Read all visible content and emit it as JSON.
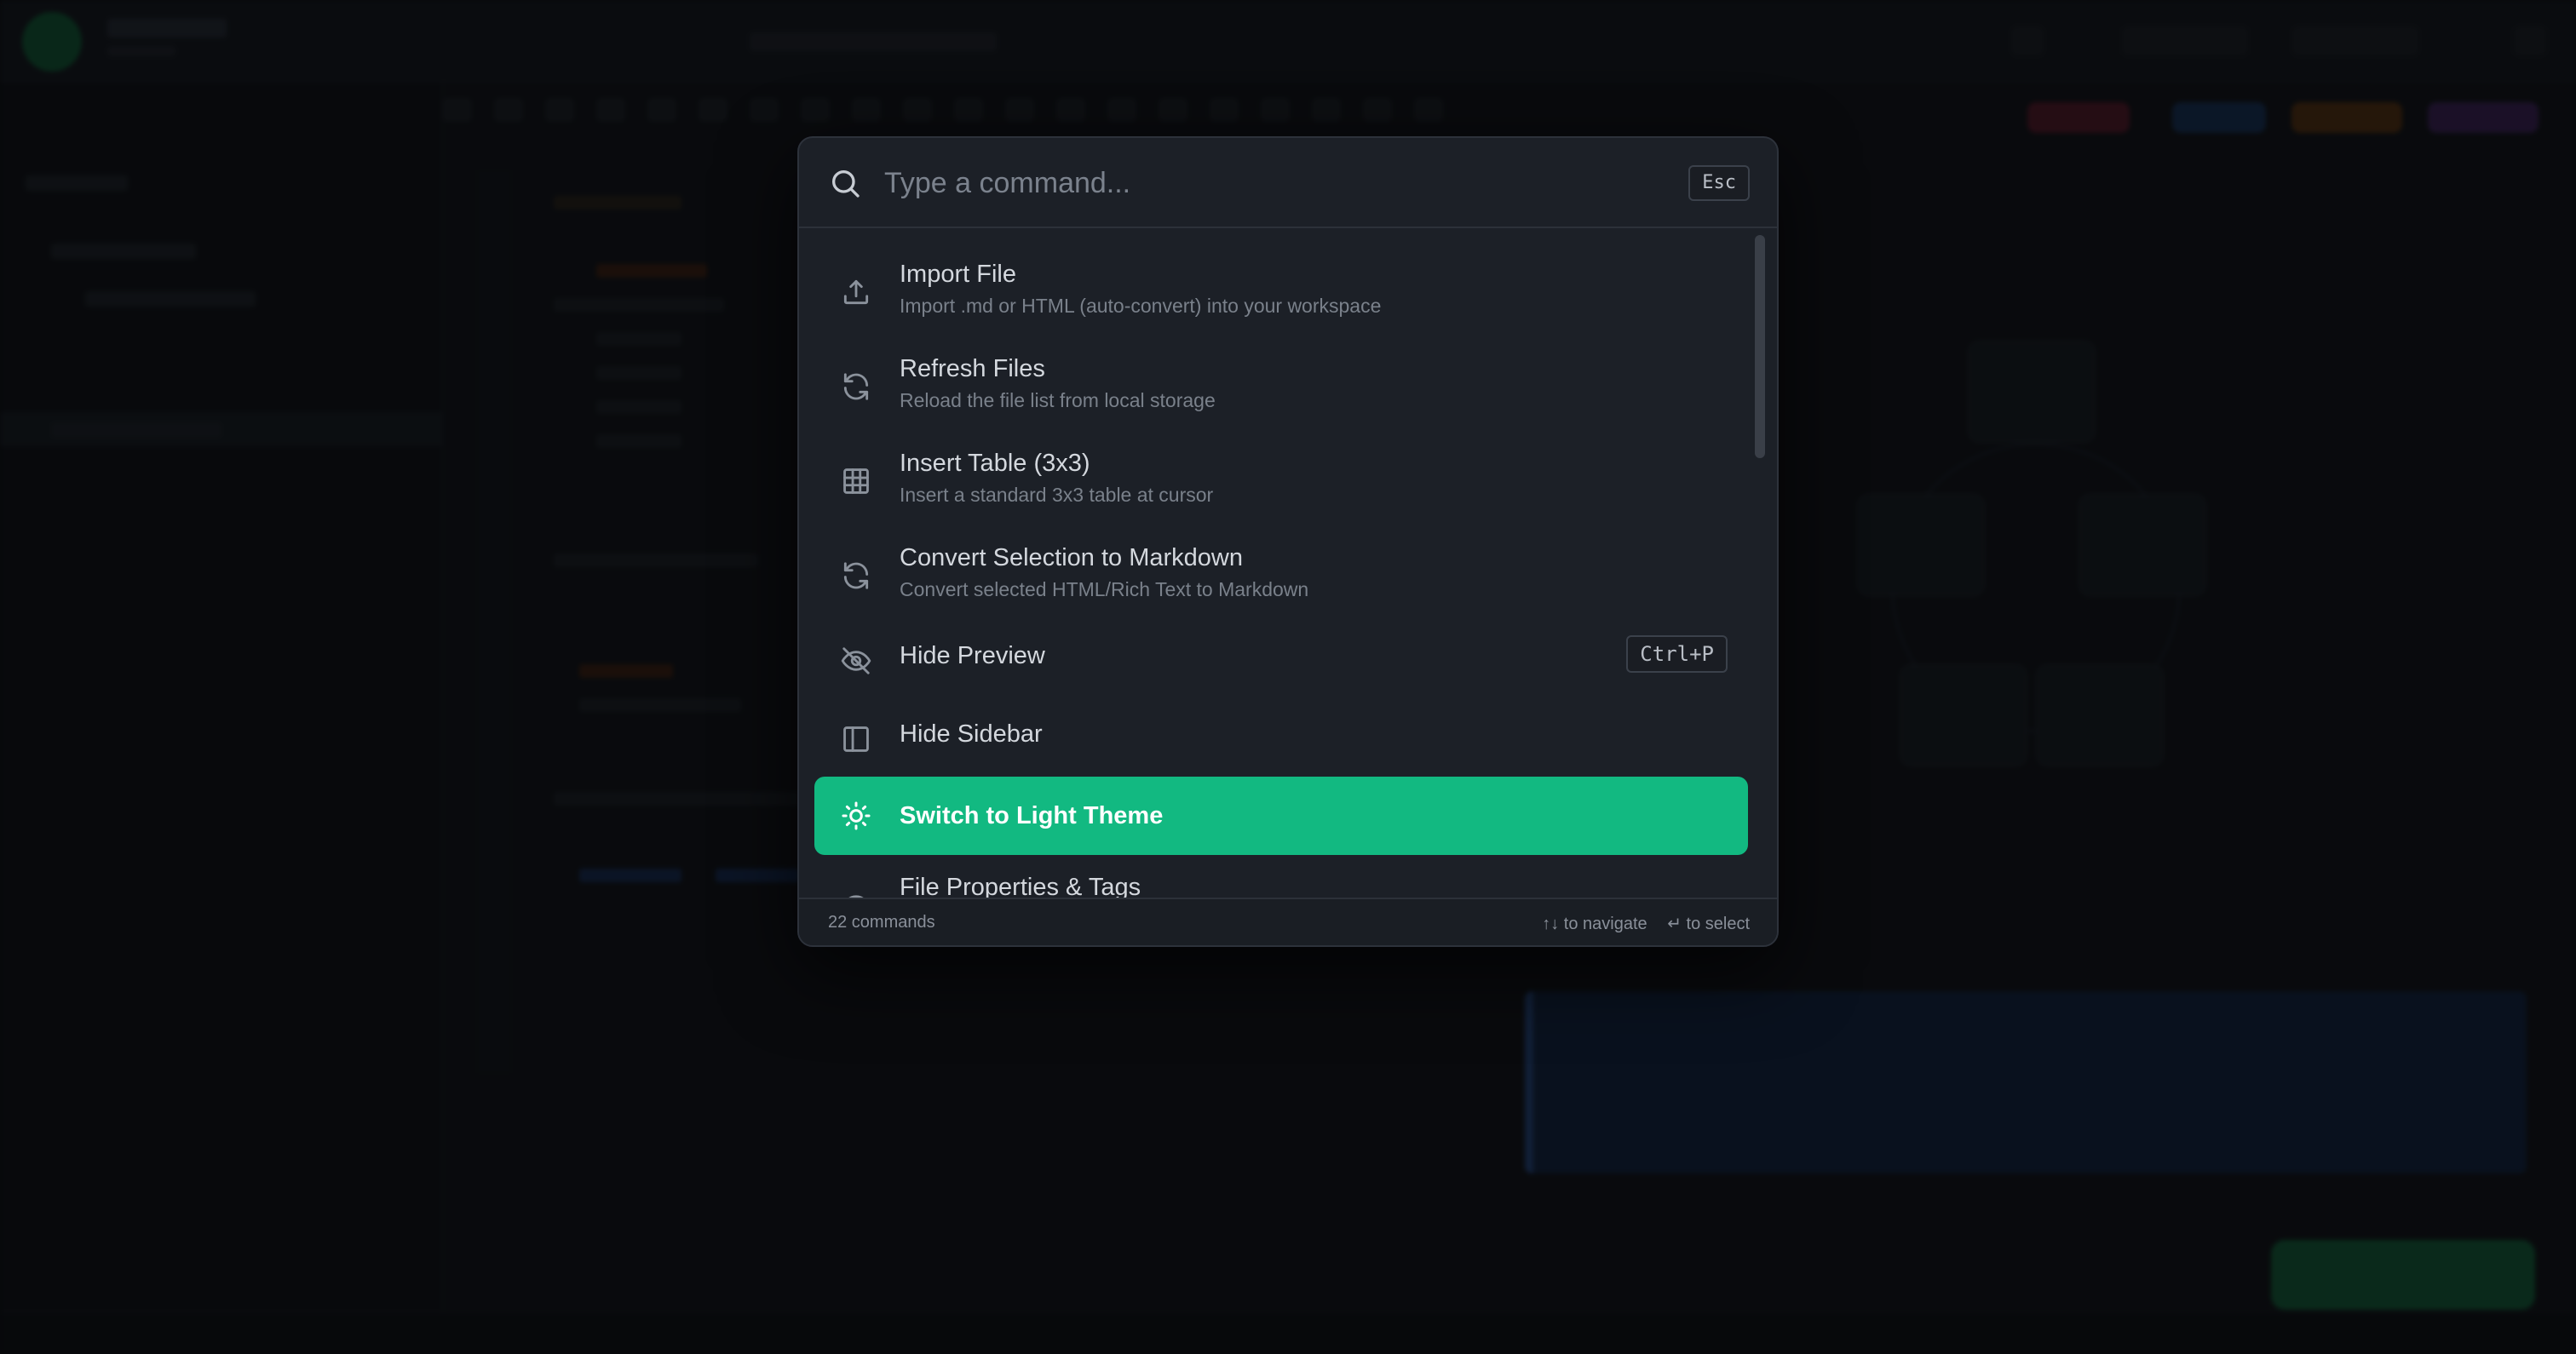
{
  "palette": {
    "search": {
      "placeholder": "Type a command...",
      "value": ""
    },
    "esc_label": "Esc",
    "commands": [
      {
        "title": "Import File",
        "description": "Import .md or HTML (auto-convert) into your workspace",
        "icon": "upload-icon"
      },
      {
        "title": "Refresh Files",
        "description": "Reload the file list from local storage",
        "icon": "refresh-icon"
      },
      {
        "title": "Insert Table (3x3)",
        "description": "Insert a standard 3x3 table at cursor",
        "icon": "table-icon"
      },
      {
        "title": "Convert Selection to Markdown",
        "description": "Convert selected HTML/Rich Text to Markdown",
        "icon": "refresh-icon"
      },
      {
        "title": "Hide Preview",
        "shortcut": "Ctrl+P",
        "icon": "eye-off-icon"
      },
      {
        "title": "Hide Sidebar",
        "icon": "sidebar-icon"
      },
      {
        "title": "Switch to Light Theme",
        "icon": "sun-icon",
        "selected": true
      },
      {
        "title": "File Properties & Tags",
        "icon": "info-icon"
      }
    ],
    "footer": {
      "count": "22 commands",
      "navigate_hint": "↑↓ to navigate",
      "select_hint": "↵ to select"
    }
  },
  "colors": {
    "accent": "#12b981",
    "palette_bg": "#1c2027",
    "backdrop": "#0b0d10"
  }
}
